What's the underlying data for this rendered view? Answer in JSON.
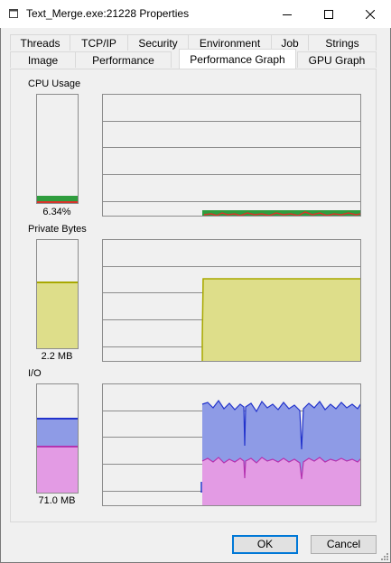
{
  "window": {
    "title": "Text_Merge.exe:21228 Properties"
  },
  "tabs_row1": [
    "Threads",
    "TCP/IP",
    "Security",
    "Environment",
    "Job",
    "Strings"
  ],
  "tabs_row2": [
    "Image",
    "Performance",
    "Performance Graph",
    "GPU Graph"
  ],
  "active_tab": "Performance Graph",
  "cpu": {
    "label": "CPU Usage",
    "value": "6.34%",
    "fraction": 0.0634
  },
  "private_bytes": {
    "label": "Private Bytes",
    "value": "2.2 MB",
    "fraction": 0.6
  },
  "io": {
    "label": "I/O",
    "value": "71.0  MB",
    "read_fraction": 0.5,
    "write_fraction": 0.56
  },
  "buttons": {
    "ok": "OK",
    "cancel": "Cancel"
  },
  "colors": {
    "cpu_kernel": "#d9332b",
    "cpu_total": "#2f9d3e",
    "private_bytes": "#dede8a",
    "private_bytes_line": "#a8a800",
    "io_read": "#8e9be6",
    "io_read_line": "#2233cc",
    "io_write": "#e39be4",
    "io_write_line": "#b533b0",
    "accent": "#0078d7"
  }
}
